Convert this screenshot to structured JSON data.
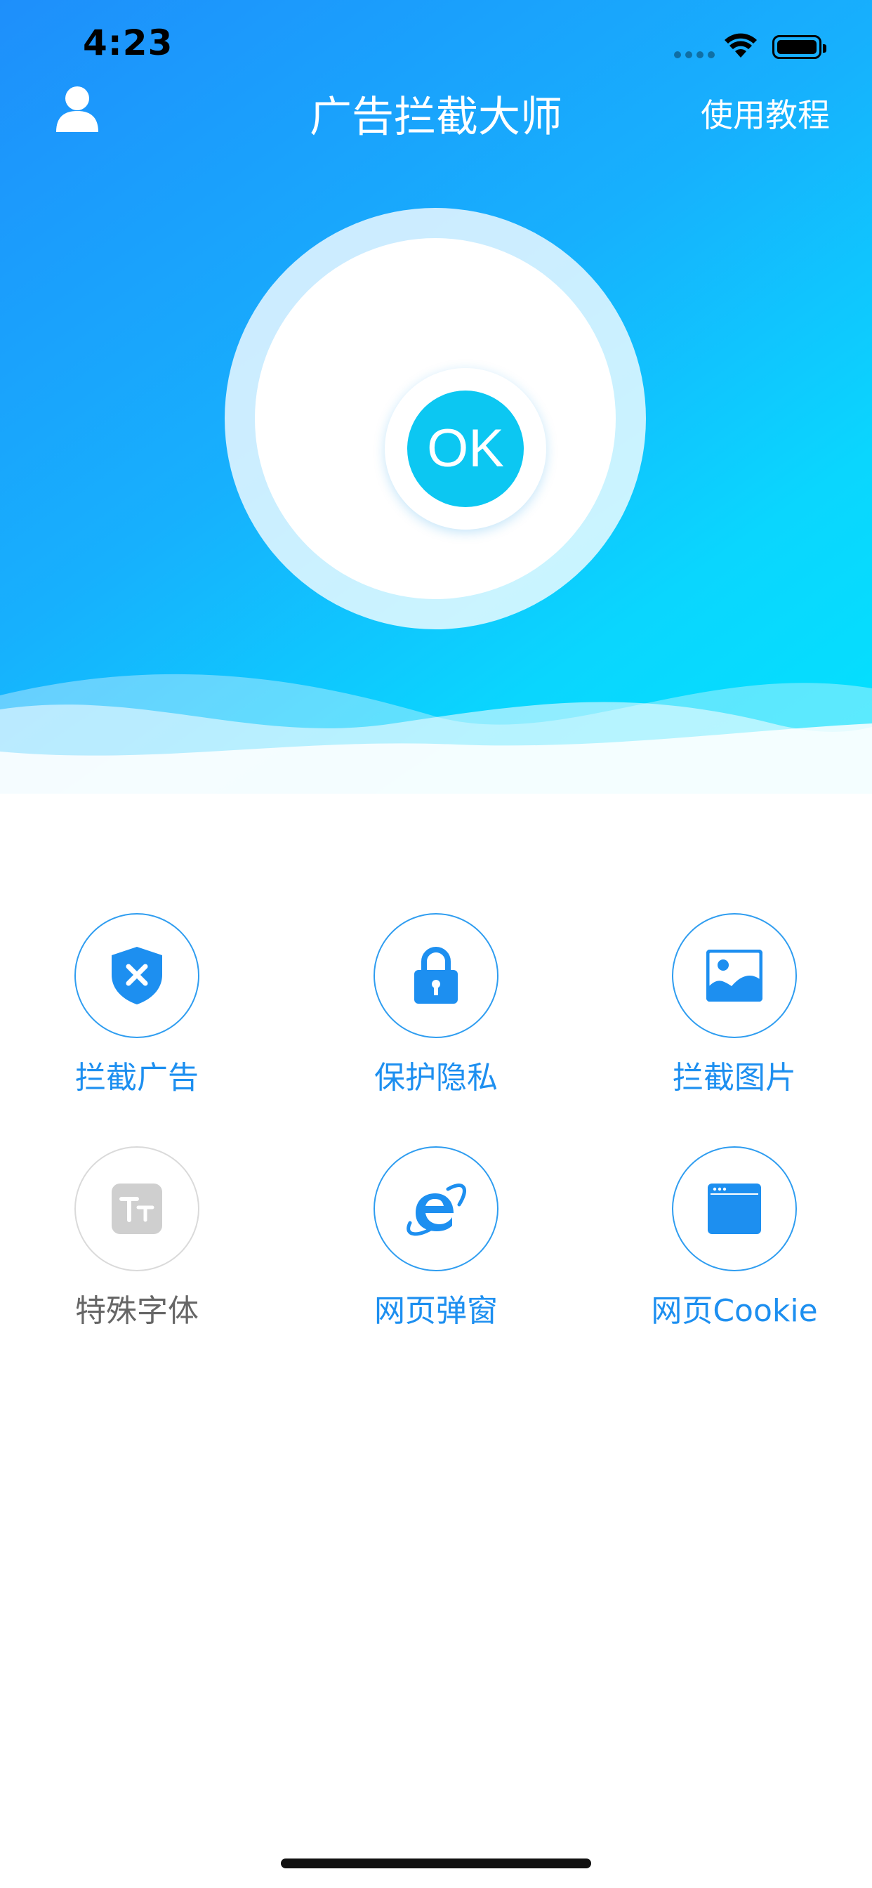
{
  "status_bar": {
    "time": "4:23"
  },
  "nav": {
    "title": "广告拦截大师",
    "tutorial_label": "使用教程"
  },
  "status": {
    "ok_label": "OK"
  },
  "features": [
    {
      "label": "拦截广告",
      "icon": "shield-x-icon",
      "enabled": true
    },
    {
      "label": "保护隐私",
      "icon": "lock-icon",
      "enabled": true
    },
    {
      "label": "拦截图片",
      "icon": "image-icon",
      "enabled": true
    },
    {
      "label": "特殊字体",
      "icon": "font-icon",
      "enabled": false
    },
    {
      "label": "网页弹窗",
      "icon": "ie-browser-icon",
      "enabled": true
    },
    {
      "label": "网页Cookie",
      "icon": "browser-window-icon",
      "enabled": true
    }
  ],
  "colors": {
    "accent": "#1d8ff0",
    "ok": "#0cc7f2",
    "disabled": "#cfcfcf"
  }
}
